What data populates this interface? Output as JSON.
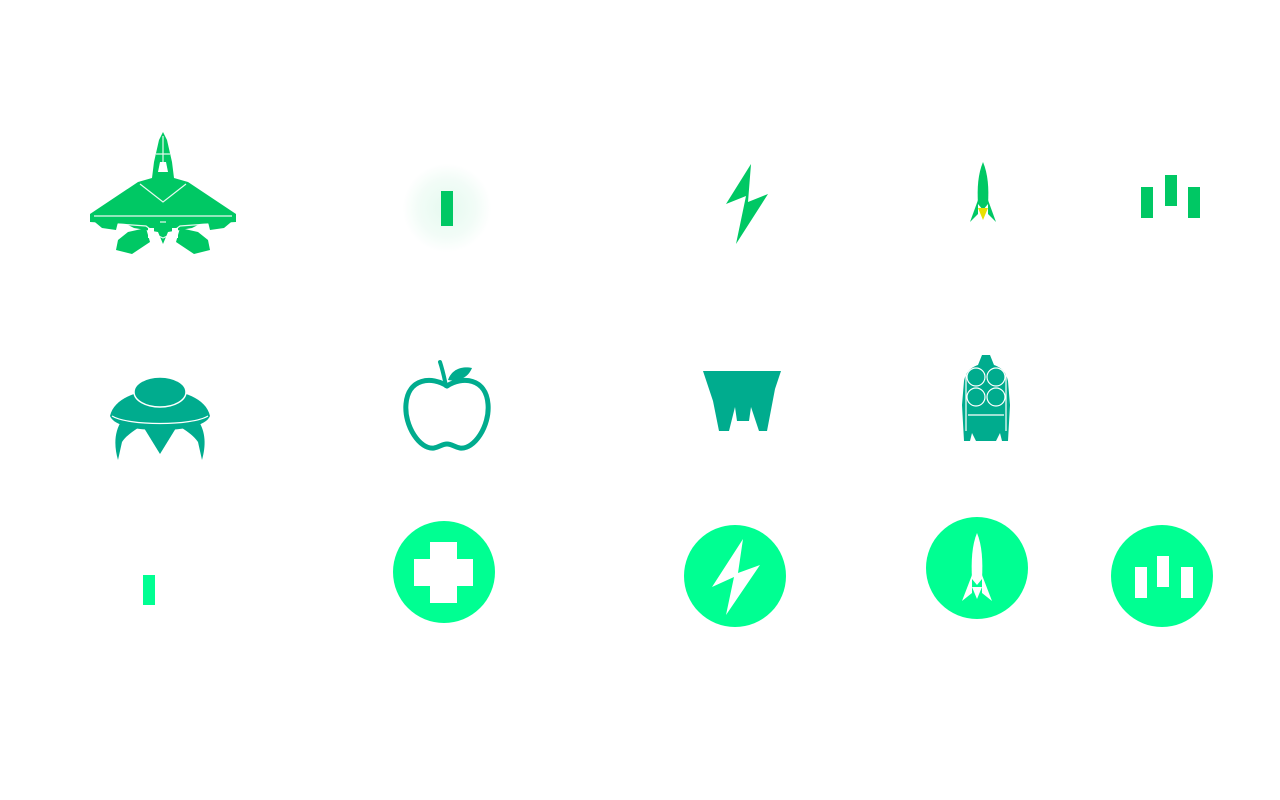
{
  "colors": {
    "player_green": "#00C864",
    "player_green_dark": "#03B85A",
    "enemy_teal": "#00AC8E",
    "powerup_bg": "#00FF92",
    "flame_yellow": "#E8E000",
    "white": "#FFFFFF"
  },
  "sprites": {
    "row_player": [
      "player-ship",
      "player-bullet",
      "lightning-bolt",
      "player-missile",
      "triple-bar-pickup"
    ],
    "row_enemy": [
      "enemy-ufo",
      "enemy-apple",
      "enemy-fortress",
      "enemy-pod"
    ],
    "row_powerups": [
      "small-bullet",
      "health-powerup",
      "lightning-powerup",
      "missile-powerup",
      "triple-shot-powerup"
    ]
  }
}
